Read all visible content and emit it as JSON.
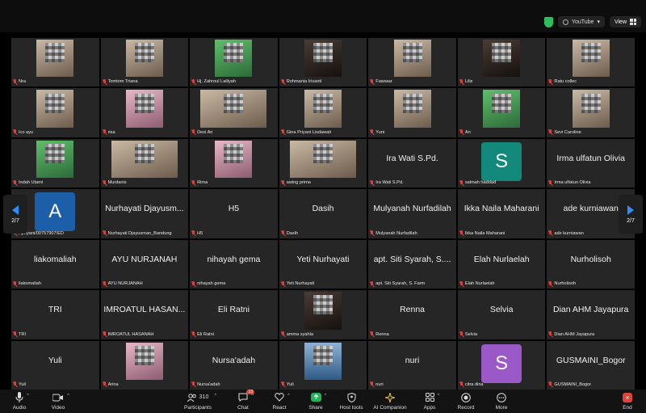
{
  "topbar": {
    "youtube_label": "YouTube",
    "view_label": "View"
  },
  "pager": {
    "left_page": "2/7",
    "right_page": "2/7"
  },
  "tiles": [
    {
      "kind": "video",
      "style": "",
      "label": "Nra"
    },
    {
      "kind": "video",
      "style": "",
      "label": "Tomtom Triana"
    },
    {
      "kind": "video",
      "style": "green",
      "label": "Hj. Zahroul Lailiyah"
    },
    {
      "kind": "video",
      "style": "dark",
      "label": "Rohmania Irisanti"
    },
    {
      "kind": "video",
      "style": "",
      "label": "Fawwaz"
    },
    {
      "kind": "video",
      "style": "dark",
      "label": "Lilis"
    },
    {
      "kind": "video",
      "style": "",
      "label": "Ratu collec"
    },
    {
      "kind": "video",
      "style": "",
      "label": "Ico ayu"
    },
    {
      "kind": "video",
      "style": "pink",
      "label": "risa"
    },
    {
      "kind": "video",
      "style": "wide",
      "label": "Desi Ari"
    },
    {
      "kind": "video",
      "style": "",
      "label": "Gina Priyani Lisdawati"
    },
    {
      "kind": "video",
      "style": "",
      "label": "Yuni"
    },
    {
      "kind": "video",
      "style": "green",
      "label": "Ari"
    },
    {
      "kind": "video",
      "style": "",
      "label": "Sevi Caroline"
    },
    {
      "kind": "video",
      "style": "green",
      "label": "Indah Utami"
    },
    {
      "kind": "video",
      "style": "wide",
      "label": "Murdanis"
    },
    {
      "kind": "video",
      "style": "pink",
      "label": "Rima"
    },
    {
      "kind": "video",
      "style": "wide",
      "label": "awing prima"
    },
    {
      "kind": "name",
      "name": "Ira Wati S.Pd.",
      "label": "Ira Wati S.Pd."
    },
    {
      "kind": "avatar",
      "letter": "S",
      "color": "#12897a",
      "label": "salmah haddad"
    },
    {
      "kind": "name",
      "name": "Irma ulfatun Olivia",
      "label": "Irma ulfatun Olivia"
    },
    {
      "kind": "avatar",
      "letter": "A",
      "color": "#1c5fa8",
      "label": "Apriyani/00757907/ED"
    },
    {
      "kind": "name",
      "name": "Nurhayati Djayusm...",
      "label": "Nurhayati Djayusman_Bandung"
    },
    {
      "kind": "name",
      "name": "H5",
      "label": "H5"
    },
    {
      "kind": "name",
      "name": "Dasih",
      "label": "Dasih"
    },
    {
      "kind": "name",
      "name": "Mulyanah Nurfadilah",
      "label": "Mulyanah Nurfadilah"
    },
    {
      "kind": "name",
      "name": "Ikka Naila Maharani",
      "label": "Ikka Naila Maharani"
    },
    {
      "kind": "name",
      "name": "ade kurniawan",
      "label": "ade kurniawan"
    },
    {
      "kind": "name",
      "name": "liakomaliah",
      "label": "liakomaliah"
    },
    {
      "kind": "name",
      "name": "AYU NURJANAH",
      "label": "AYU NURJANAH"
    },
    {
      "kind": "name",
      "name": "nihayah gema",
      "label": "nihayah gema"
    },
    {
      "kind": "name",
      "name": "Yeti Nurhayati",
      "label": "Yeti Nurhayati"
    },
    {
      "kind": "name",
      "name": "apt. Siti Syarah, S....",
      "label": "apt. Siti Syarah, S. Farm"
    },
    {
      "kind": "name",
      "name": "Elah Nurlaelah",
      "label": "Elah Nurlaelah"
    },
    {
      "kind": "name",
      "name": "Nurholisoh",
      "label": "Nurholisoh"
    },
    {
      "kind": "name",
      "name": "TRI",
      "label": "TRI"
    },
    {
      "kind": "name",
      "name": "IMROATUL HASAN...",
      "label": "IMROATUL HASANAH"
    },
    {
      "kind": "name",
      "name": "Eli Ratni",
      "label": "Eli Ratni"
    },
    {
      "kind": "video",
      "style": "dark",
      "label": "amma syahla"
    },
    {
      "kind": "name",
      "name": "Renna",
      "label": "Renna"
    },
    {
      "kind": "name",
      "name": "Selvia",
      "label": "Selvia"
    },
    {
      "kind": "name",
      "name": "Dian AHM Jayapura",
      "label": "Dian AHM Jayapura"
    },
    {
      "kind": "name",
      "name": "Yuli",
      "label": "Yuli"
    },
    {
      "kind": "video",
      "style": "pink",
      "label": "Arina"
    },
    {
      "kind": "name",
      "name": "Nursa'adah",
      "label": "Nursa'adah"
    },
    {
      "kind": "video",
      "style": "sky",
      "label": "Yuli"
    },
    {
      "kind": "name",
      "name": "nuri",
      "label": "nuri"
    },
    {
      "kind": "avatar",
      "letter": "S",
      "color": "#9b59c7",
      "label": "citra dina"
    },
    {
      "kind": "name",
      "name": "GUSMAINI_Bogor",
      "label": "GUSMAINI_Bogor"
    }
  ],
  "toolbar": {
    "audio": "Audio",
    "video": "Video",
    "participants": "Participants",
    "participants_count": "310",
    "chat": "Chat",
    "chat_badge": "13",
    "react": "React",
    "share": "Share",
    "host_tools": "Host tools",
    "ai_companion": "AI Companion",
    "apps": "Apps",
    "record": "Record",
    "more": "More",
    "end": "End"
  },
  "colors": {
    "accent": "#2d8cff",
    "muted_red": "#e0413a",
    "share_green": "#22b35a"
  }
}
